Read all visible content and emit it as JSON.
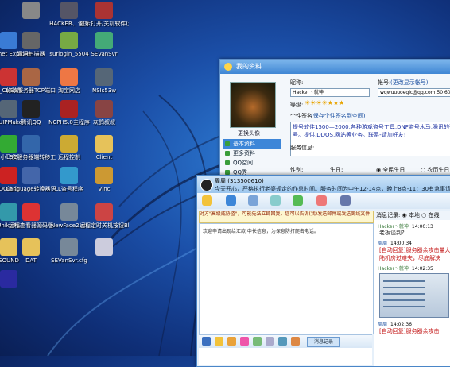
{
  "desktop": {
    "icons": [
      {
        "label": "",
        "x": 0,
        "y": 0,
        "color": "#888"
      },
      {
        "label": "HACKER、读书",
        "color": "#556"
      },
      {
        "label": "显示打开/关机软件(远程)...",
        "color": "#a33"
      },
      {
        "label": "Internet Explorer",
        "color": "#3a7bd5"
      },
      {
        "label": "漏洞扫描器",
        "color": "#666"
      },
      {
        "label": "surlogin_5504",
        "color": "#7a4"
      },
      {
        "label": "SEVanSvr",
        "color": "#4a7"
      },
      {
        "label": "P_CLIENT",
        "color": "#c33"
      },
      {
        "label": "修改服务器TCP端口",
        "color": "#a64"
      },
      {
        "label": "淘宝网店",
        "color": "#e74"
      },
      {
        "label": "NSIs53w",
        "color": "#567"
      },
      {
        "label": "FUIPMake",
        "color": "#567"
      },
      {
        "label": "腾讯QQ",
        "color": "#222"
      },
      {
        "label": "NCPH5.0主程序",
        "color": "#a22"
      },
      {
        "label": "灰鸽叔叔",
        "color": "#844"
      },
      {
        "label": "小飞侠",
        "color": "#3a3"
      },
      {
        "label": "LSC服务器端转移工具",
        "color": "#36a"
      },
      {
        "label": "远程控制",
        "color": "#ca3"
      },
      {
        "label": "Client",
        "color": "#e6c25a"
      },
      {
        "label": "QQ盗窃",
        "color": "#c22"
      },
      {
        "label": "Language转换器语言版",
        "color": "#46a"
      },
      {
        "label": "LL盗号程序",
        "color": "#39c"
      },
      {
        "label": "Vlnc",
        "color": "#c93"
      },
      {
        "label": "UnikURL",
        "color": "#39a"
      },
      {
        "label": "远程查看器源码版",
        "color": "#d33"
      },
      {
        "label": "NewFace2.clf",
        "color": "#789"
      },
      {
        "label": "远程定时关机按钮Bldav",
        "color": "#c44"
      },
      {
        "label": "SOUND",
        "color": "#e6c25a"
      },
      {
        "label": "DAT",
        "color": "#e6c25a"
      },
      {
        "label": "SEVanSvr.cfg",
        "color": "#789"
      },
      {
        "label": "",
        "color": "#ccd"
      },
      {
        "label": "",
        "color": "#2a2aa0"
      }
    ]
  },
  "profile_window": {
    "title": "我的资料",
    "change_avatar": "更换头像",
    "sidebar": [
      "基本资料",
      "更多资料",
      "QQ空间",
      "QQ秀"
    ],
    "nickname_label": "昵称:",
    "nickname_value": "Hacker丶就神",
    "account_label": "帐号:",
    "account_link": "(更改显示帐号)",
    "email_value": "wqwuuuoegic@qq.com 50 605 1006",
    "level_label": "等级:",
    "signature_label": "个性签名",
    "signature_link": "(保存个性签名到空间)",
    "signature_text": "提号软件1500—2000,各种游戏盗号工具,DNF盗号木马,腾讯的盗号。提供,DDOS,网站等业务。联系-请加好友!",
    "status_label": "服务信息:",
    "gender_label": "性别:",
    "birthday_label": "生日:",
    "radio_public": "全民生日",
    "radio_private": "农历生日"
  },
  "chat_window": {
    "title": "周周 (313500610)",
    "subtitle": "今天开心，严格执行老婆规定的作息时间。服务时间为中午12-14点，晚上8点-11：30有急事请留言",
    "notice": "对方\"高级威胁盗\"，可能先法立即回复，您可以告诉(我)发送邮件或发送离线文件",
    "chat_message": "欢迎申请出现给汇款  中长信息，为保息防打爬击电话。",
    "history_button": "消息记录",
    "history_header": "消息记录:",
    "history_option_local": "本地",
    "history_option_online": "在线",
    "messages": [
      {
        "sender": "Hacker丶就神",
        "time": "14:00:13",
        "text": "老板谈判?"
      },
      {
        "sender": "周周",
        "time": "14:00:34",
        "text": "[自动回复]服务器余攻击量大本陆机房过难夹，尽底解决"
      },
      {
        "sender": "Hacker丶就神",
        "time": "14:02:35",
        "text": ""
      },
      {
        "sender": "周周",
        "time": "14:02:36",
        "text": "[自动回复]服务器余攻击"
      }
    ]
  }
}
